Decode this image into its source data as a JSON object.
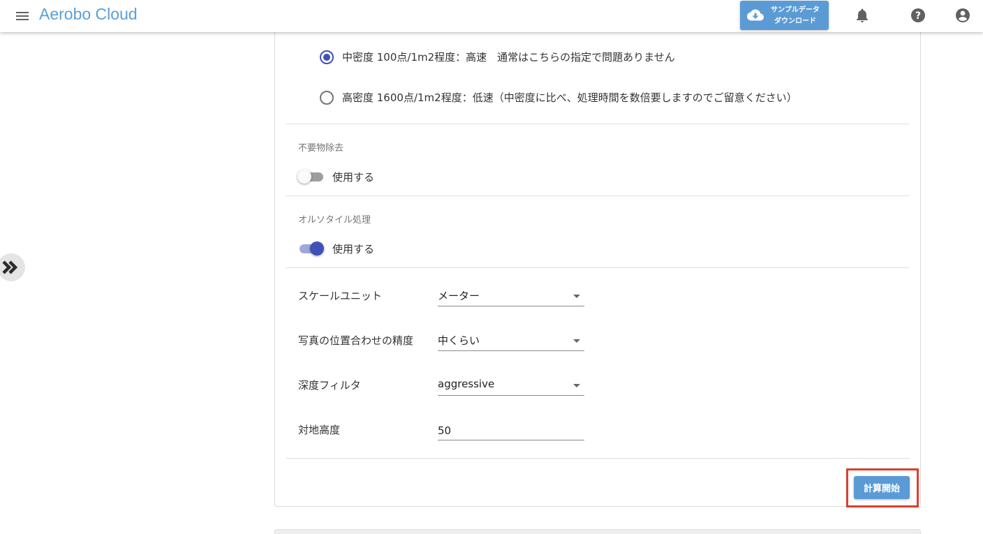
{
  "app": {
    "title": "Aerobo Cloud"
  },
  "header": {
    "sample_download_label": "サンプルデータ ダウンロード"
  },
  "density": {
    "options": [
      {
        "label": "中密度 100点/1m2程度：高速　通常はこちらの指定で問題ありません",
        "selected": true
      },
      {
        "label": "高密度 1600点/1m2程度：低速（中密度に比べ、処理時間を数倍要しますのでご留意ください）",
        "selected": false
      }
    ]
  },
  "noise_removal": {
    "title": "不要物除去",
    "switch_label": "使用する",
    "enabled": false
  },
  "ortho_tile": {
    "title": "オルソタイル処理",
    "switch_label": "使用する",
    "enabled": true
  },
  "fields": {
    "scale_unit": {
      "label": "スケールユニット",
      "value": "メーター"
    },
    "photo_alignment": {
      "label": "写真の位置合わせの精度",
      "value": "中くらい"
    },
    "depth_filter": {
      "label": "深度フィルタ",
      "value": "aggressive"
    },
    "altitude": {
      "label": "対地高度",
      "value": "50"
    }
  },
  "actions": {
    "calculate_label": "計算開始"
  },
  "colors": {
    "accent": "#3f51b5",
    "button": "#5b9bd5",
    "title": "#5a9fd6",
    "highlight": "#d9402e"
  }
}
